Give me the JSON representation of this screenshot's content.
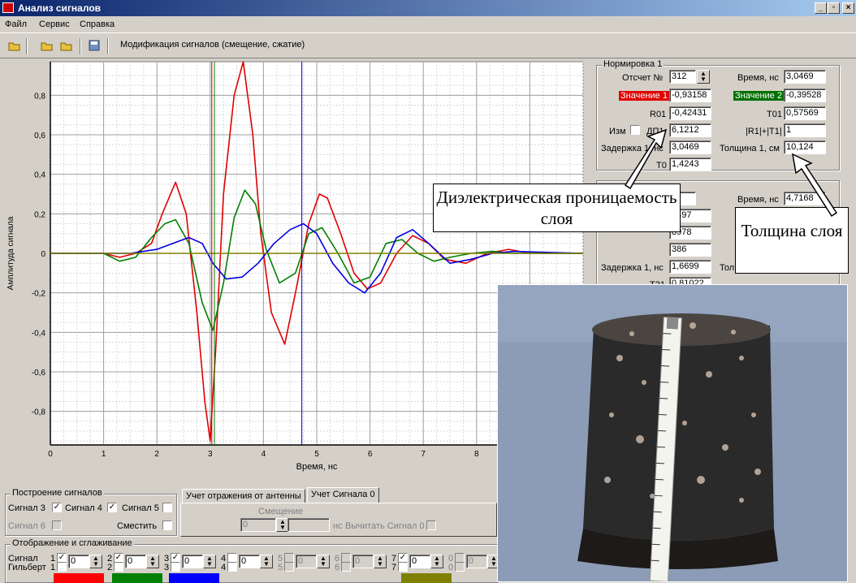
{
  "window": {
    "title": "Анализ сигналов"
  },
  "menu": [
    "Файл",
    "Сервис",
    "Справка"
  ],
  "toolbar": {
    "label": "Модификация сигналов (смещение, сжатие)"
  },
  "chart_data": {
    "type": "line",
    "xlabel": "Время, нс",
    "ylabel": "Амплитуда сигнала",
    "xlim": [
      0,
      10
    ],
    "ylim": [
      -0.97,
      0.97
    ],
    "xticks": [
      0,
      1,
      2,
      3,
      4,
      5,
      6,
      7,
      8
    ],
    "yticks": [
      0.8,
      0.6,
      0.4,
      0.2,
      0,
      -0.2,
      -0.4,
      -0.6,
      -0.8
    ],
    "ytick_labels": [
      "0,8",
      "0,6",
      "0,4",
      "0,2",
      "0",
      "-0,2",
      "-0,4",
      "-0,6",
      "-0,8"
    ],
    "grid": true,
    "cursors": [
      {
        "x": 3.03,
        "color": "#c00000"
      },
      {
        "x": 3.08,
        "color": "#008000"
      },
      {
        "x": 4.72,
        "color": "#0000c0"
      }
    ],
    "series": [
      {
        "color": "#e00000",
        "x": [
          0,
          1.0,
          1.3,
          1.6,
          1.9,
          2.1,
          2.35,
          2.55,
          2.75,
          2.9,
          3.0,
          3.1,
          3.25,
          3.45,
          3.62,
          3.8,
          3.95,
          4.15,
          4.4,
          4.6,
          4.85,
          5.05,
          5.2,
          5.45,
          5.7,
          5.95,
          6.2,
          6.5,
          6.8,
          7.1,
          7.4,
          7.8,
          8.2,
          8.6,
          9.0,
          10
        ],
        "y": [
          0,
          0,
          -0.02,
          0,
          0.05,
          0.2,
          0.36,
          0.2,
          -0.3,
          -0.75,
          -0.95,
          -0.5,
          0.3,
          0.8,
          0.97,
          0.6,
          0.1,
          -0.3,
          -0.46,
          -0.2,
          0.15,
          0.3,
          0.28,
          0.1,
          -0.1,
          -0.18,
          -0.15,
          0.0,
          0.09,
          0.05,
          -0.03,
          -0.05,
          0.0,
          0.02,
          0,
          0
        ]
      },
      {
        "color": "#008000",
        "x": [
          0,
          1.0,
          1.3,
          1.6,
          1.9,
          2.15,
          2.35,
          2.6,
          2.85,
          3.05,
          3.25,
          3.45,
          3.65,
          3.85,
          4.05,
          4.3,
          4.6,
          4.85,
          5.1,
          5.4,
          5.7,
          6.0,
          6.3,
          6.6,
          6.9,
          7.2,
          7.5,
          7.9,
          8.3,
          8.7,
          10
        ],
        "y": [
          0,
          0,
          -0.04,
          -0.02,
          0.08,
          0.15,
          0.17,
          0.05,
          -0.25,
          -0.39,
          -0.15,
          0.18,
          0.32,
          0.25,
          0.02,
          -0.15,
          -0.1,
          0.1,
          0.13,
          0.0,
          -0.15,
          -0.12,
          0.05,
          0.07,
          0.0,
          -0.04,
          -0.02,
          0.0,
          0.01,
          0,
          0
        ]
      },
      {
        "color": "#0000e0",
        "x": [
          0,
          1.0,
          1.5,
          2.0,
          2.3,
          2.6,
          2.85,
          3.05,
          3.3,
          3.6,
          3.9,
          4.2,
          4.5,
          4.75,
          5.0,
          5.3,
          5.6,
          5.9,
          6.2,
          6.5,
          6.8,
          7.1,
          7.5,
          7.9,
          8.3,
          8.7,
          10
        ],
        "y": [
          0,
          0,
          0,
          0.02,
          0.05,
          0.08,
          0.05,
          -0.05,
          -0.13,
          -0.12,
          -0.05,
          0.05,
          0.12,
          0.15,
          0.1,
          -0.05,
          -0.15,
          -0.2,
          -0.1,
          0.08,
          0.12,
          0.05,
          -0.05,
          -0.03,
          0.0,
          0.01,
          0
        ]
      },
      {
        "color": "#808000",
        "x": [
          0,
          10
        ],
        "y": [
          0,
          0
        ]
      }
    ]
  },
  "norm1": {
    "title": "Нормировка 1",
    "otschet_label": "Отсчет №",
    "otschet_value": "312",
    "time_label": "Время, нс",
    "time_value": "3,0469",
    "val1_label": "Значение 1",
    "val1_value": "-0,93158",
    "val2_label": "Значение 2",
    "val2_value": "-0,39528",
    "r01_label": "R01",
    "r01_value": "-0,42431",
    "t01_label": "T01",
    "t01_value": "0,57569",
    "izm_label": "Изм",
    "dp_label": "ДП1",
    "dp_value": "6,1212",
    "sum_label": "|R1|+|T1|",
    "sum_value": "1",
    "delay_label": "Задержка 1, нс",
    "delay_value": "3,0469",
    "thick_label": "Толщина 1, см",
    "thick_value": "10,124",
    "t0_label": "T0",
    "t0_value": "1,4243"
  },
  "norm2": {
    "time_label": "Время, нс",
    "time_value": "4,7168",
    "otschet_value": "3",
    "v1": "4497",
    "v2": "8978",
    "v3": "386",
    "delay_label": "Задержка 1, нс",
    "delay_value": "1,6699",
    "thick_label_partial": "Тол",
    "t21_label": "T21",
    "t21_value": "0,81022"
  },
  "callouts": {
    "dielectric": "Диэлектрическая проницаемость слоя",
    "thickness": "Толщина слоя"
  },
  "build": {
    "title": "Построение сигналов",
    "sig3": "Сигнал 3",
    "sig4": "Сигнал 4",
    "sig5": "Сигнал 5",
    "sig6": "Сигнал 6",
    "shift": "Сместить"
  },
  "tabs": {
    "tab1": "Учет отражения от антенны",
    "tab2": "Учет Сигнала 0",
    "offset_label": "Смещение",
    "offset_value": "0",
    "ns_label": "нс",
    "subtract_label": "Вычитать Сигнал 0"
  },
  "display": {
    "title": "Отображение и сглаживание",
    "signal_label": "Сигнал",
    "hilbert_label": "Гильберт",
    "channels": [
      {
        "sig": "1",
        "hil": "1",
        "value": "0"
      },
      {
        "sig": "2",
        "hil": "2",
        "value": "0"
      },
      {
        "sig": "3",
        "hil": "3",
        "value": "0"
      },
      {
        "sig": "4",
        "hil": "4",
        "value": "0"
      },
      {
        "sig": "5",
        "hil": "5",
        "value": "0"
      },
      {
        "sig": "6",
        "hil": "6",
        "value": "0"
      },
      {
        "sig": "7",
        "hil": "7",
        "value": "0"
      },
      {
        "sig": "0",
        "hil": "0",
        "value": "0"
      }
    ],
    "bar_colors": [
      "#ff0000",
      "#008000",
      "#0000ff",
      "#808000"
    ]
  }
}
